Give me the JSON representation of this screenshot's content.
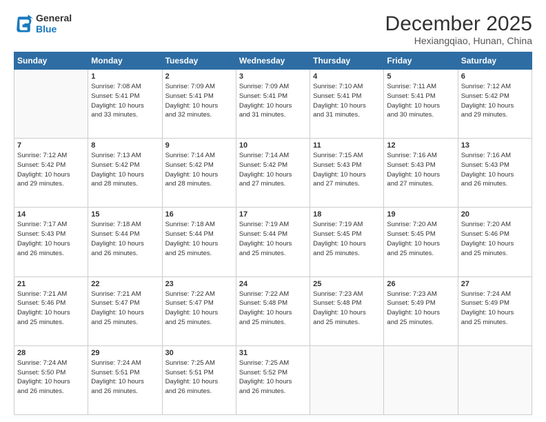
{
  "logo": {
    "line1": "General",
    "line2": "Blue"
  },
  "title": "December 2025",
  "subtitle": "Hexiangqiao, Hunan, China",
  "days_of_week": [
    "Sunday",
    "Monday",
    "Tuesday",
    "Wednesday",
    "Thursday",
    "Friday",
    "Saturday"
  ],
  "weeks": [
    [
      {
        "day": "",
        "empty": true
      },
      {
        "day": "1",
        "sunrise": "7:08 AM",
        "sunset": "5:41 PM",
        "daylight": "10 hours and 33 minutes."
      },
      {
        "day": "2",
        "sunrise": "7:09 AM",
        "sunset": "5:41 PM",
        "daylight": "10 hours and 32 minutes."
      },
      {
        "day": "3",
        "sunrise": "7:09 AM",
        "sunset": "5:41 PM",
        "daylight": "10 hours and 31 minutes."
      },
      {
        "day": "4",
        "sunrise": "7:10 AM",
        "sunset": "5:41 PM",
        "daylight": "10 hours and 31 minutes."
      },
      {
        "day": "5",
        "sunrise": "7:11 AM",
        "sunset": "5:41 PM",
        "daylight": "10 hours and 30 minutes."
      },
      {
        "day": "6",
        "sunrise": "7:12 AM",
        "sunset": "5:42 PM",
        "daylight": "10 hours and 29 minutes."
      }
    ],
    [
      {
        "day": "7",
        "sunrise": "7:12 AM",
        "sunset": "5:42 PM",
        "daylight": "10 hours and 29 minutes."
      },
      {
        "day": "8",
        "sunrise": "7:13 AM",
        "sunset": "5:42 PM",
        "daylight": "10 hours and 28 minutes."
      },
      {
        "day": "9",
        "sunrise": "7:14 AM",
        "sunset": "5:42 PM",
        "daylight": "10 hours and 28 minutes."
      },
      {
        "day": "10",
        "sunrise": "7:14 AM",
        "sunset": "5:42 PM",
        "daylight": "10 hours and 27 minutes."
      },
      {
        "day": "11",
        "sunrise": "7:15 AM",
        "sunset": "5:43 PM",
        "daylight": "10 hours and 27 minutes."
      },
      {
        "day": "12",
        "sunrise": "7:16 AM",
        "sunset": "5:43 PM",
        "daylight": "10 hours and 27 minutes."
      },
      {
        "day": "13",
        "sunrise": "7:16 AM",
        "sunset": "5:43 PM",
        "daylight": "10 hours and 26 minutes."
      }
    ],
    [
      {
        "day": "14",
        "sunrise": "7:17 AM",
        "sunset": "5:43 PM",
        "daylight": "10 hours and 26 minutes."
      },
      {
        "day": "15",
        "sunrise": "7:18 AM",
        "sunset": "5:44 PM",
        "daylight": "10 hours and 26 minutes."
      },
      {
        "day": "16",
        "sunrise": "7:18 AM",
        "sunset": "5:44 PM",
        "daylight": "10 hours and 25 minutes."
      },
      {
        "day": "17",
        "sunrise": "7:19 AM",
        "sunset": "5:44 PM",
        "daylight": "10 hours and 25 minutes."
      },
      {
        "day": "18",
        "sunrise": "7:19 AM",
        "sunset": "5:45 PM",
        "daylight": "10 hours and 25 minutes."
      },
      {
        "day": "19",
        "sunrise": "7:20 AM",
        "sunset": "5:45 PM",
        "daylight": "10 hours and 25 minutes."
      },
      {
        "day": "20",
        "sunrise": "7:20 AM",
        "sunset": "5:46 PM",
        "daylight": "10 hours and 25 minutes."
      }
    ],
    [
      {
        "day": "21",
        "sunrise": "7:21 AM",
        "sunset": "5:46 PM",
        "daylight": "10 hours and 25 minutes."
      },
      {
        "day": "22",
        "sunrise": "7:21 AM",
        "sunset": "5:47 PM",
        "daylight": "10 hours and 25 minutes."
      },
      {
        "day": "23",
        "sunrise": "7:22 AM",
        "sunset": "5:47 PM",
        "daylight": "10 hours and 25 minutes."
      },
      {
        "day": "24",
        "sunrise": "7:22 AM",
        "sunset": "5:48 PM",
        "daylight": "10 hours and 25 minutes."
      },
      {
        "day": "25",
        "sunrise": "7:23 AM",
        "sunset": "5:48 PM",
        "daylight": "10 hours and 25 minutes."
      },
      {
        "day": "26",
        "sunrise": "7:23 AM",
        "sunset": "5:49 PM",
        "daylight": "10 hours and 25 minutes."
      },
      {
        "day": "27",
        "sunrise": "7:24 AM",
        "sunset": "5:49 PM",
        "daylight": "10 hours and 25 minutes."
      }
    ],
    [
      {
        "day": "28",
        "sunrise": "7:24 AM",
        "sunset": "5:50 PM",
        "daylight": "10 hours and 26 minutes."
      },
      {
        "day": "29",
        "sunrise": "7:24 AM",
        "sunset": "5:51 PM",
        "daylight": "10 hours and 26 minutes."
      },
      {
        "day": "30",
        "sunrise": "7:25 AM",
        "sunset": "5:51 PM",
        "daylight": "10 hours and 26 minutes."
      },
      {
        "day": "31",
        "sunrise": "7:25 AM",
        "sunset": "5:52 PM",
        "daylight": "10 hours and 26 minutes."
      },
      {
        "day": "",
        "empty": true
      },
      {
        "day": "",
        "empty": true
      },
      {
        "day": "",
        "empty": true
      }
    ]
  ],
  "labels": {
    "sunrise": "Sunrise:",
    "sunset": "Sunset:",
    "daylight": "Daylight:"
  }
}
